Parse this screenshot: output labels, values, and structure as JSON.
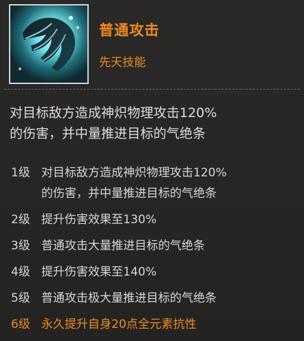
{
  "skill": {
    "name": "普通攻击",
    "type": "先天技能",
    "icon": "claw-strike-icon",
    "accent_color": "#f08a24"
  },
  "description": "对目标敌方造成神炽物理攻击120%\n的伤害，并中量推进目标的气绝条",
  "levels": [
    {
      "level": "1级",
      "text": "对目标敌方造成神炽物理攻击120%\n的伤害，并中量推进目标的气绝条"
    },
    {
      "level": "2级",
      "text": "提升伤害效果至130%"
    },
    {
      "level": "3级",
      "text": "普通攻击大量推进目标的气绝条"
    },
    {
      "level": "4级",
      "text": "提升伤害效果至140%"
    },
    {
      "level": "5级",
      "text": "普通攻击极大量推进目标的气绝条"
    },
    {
      "level": "6级",
      "text": "永久提升自身20点全元素抗性"
    }
  ]
}
